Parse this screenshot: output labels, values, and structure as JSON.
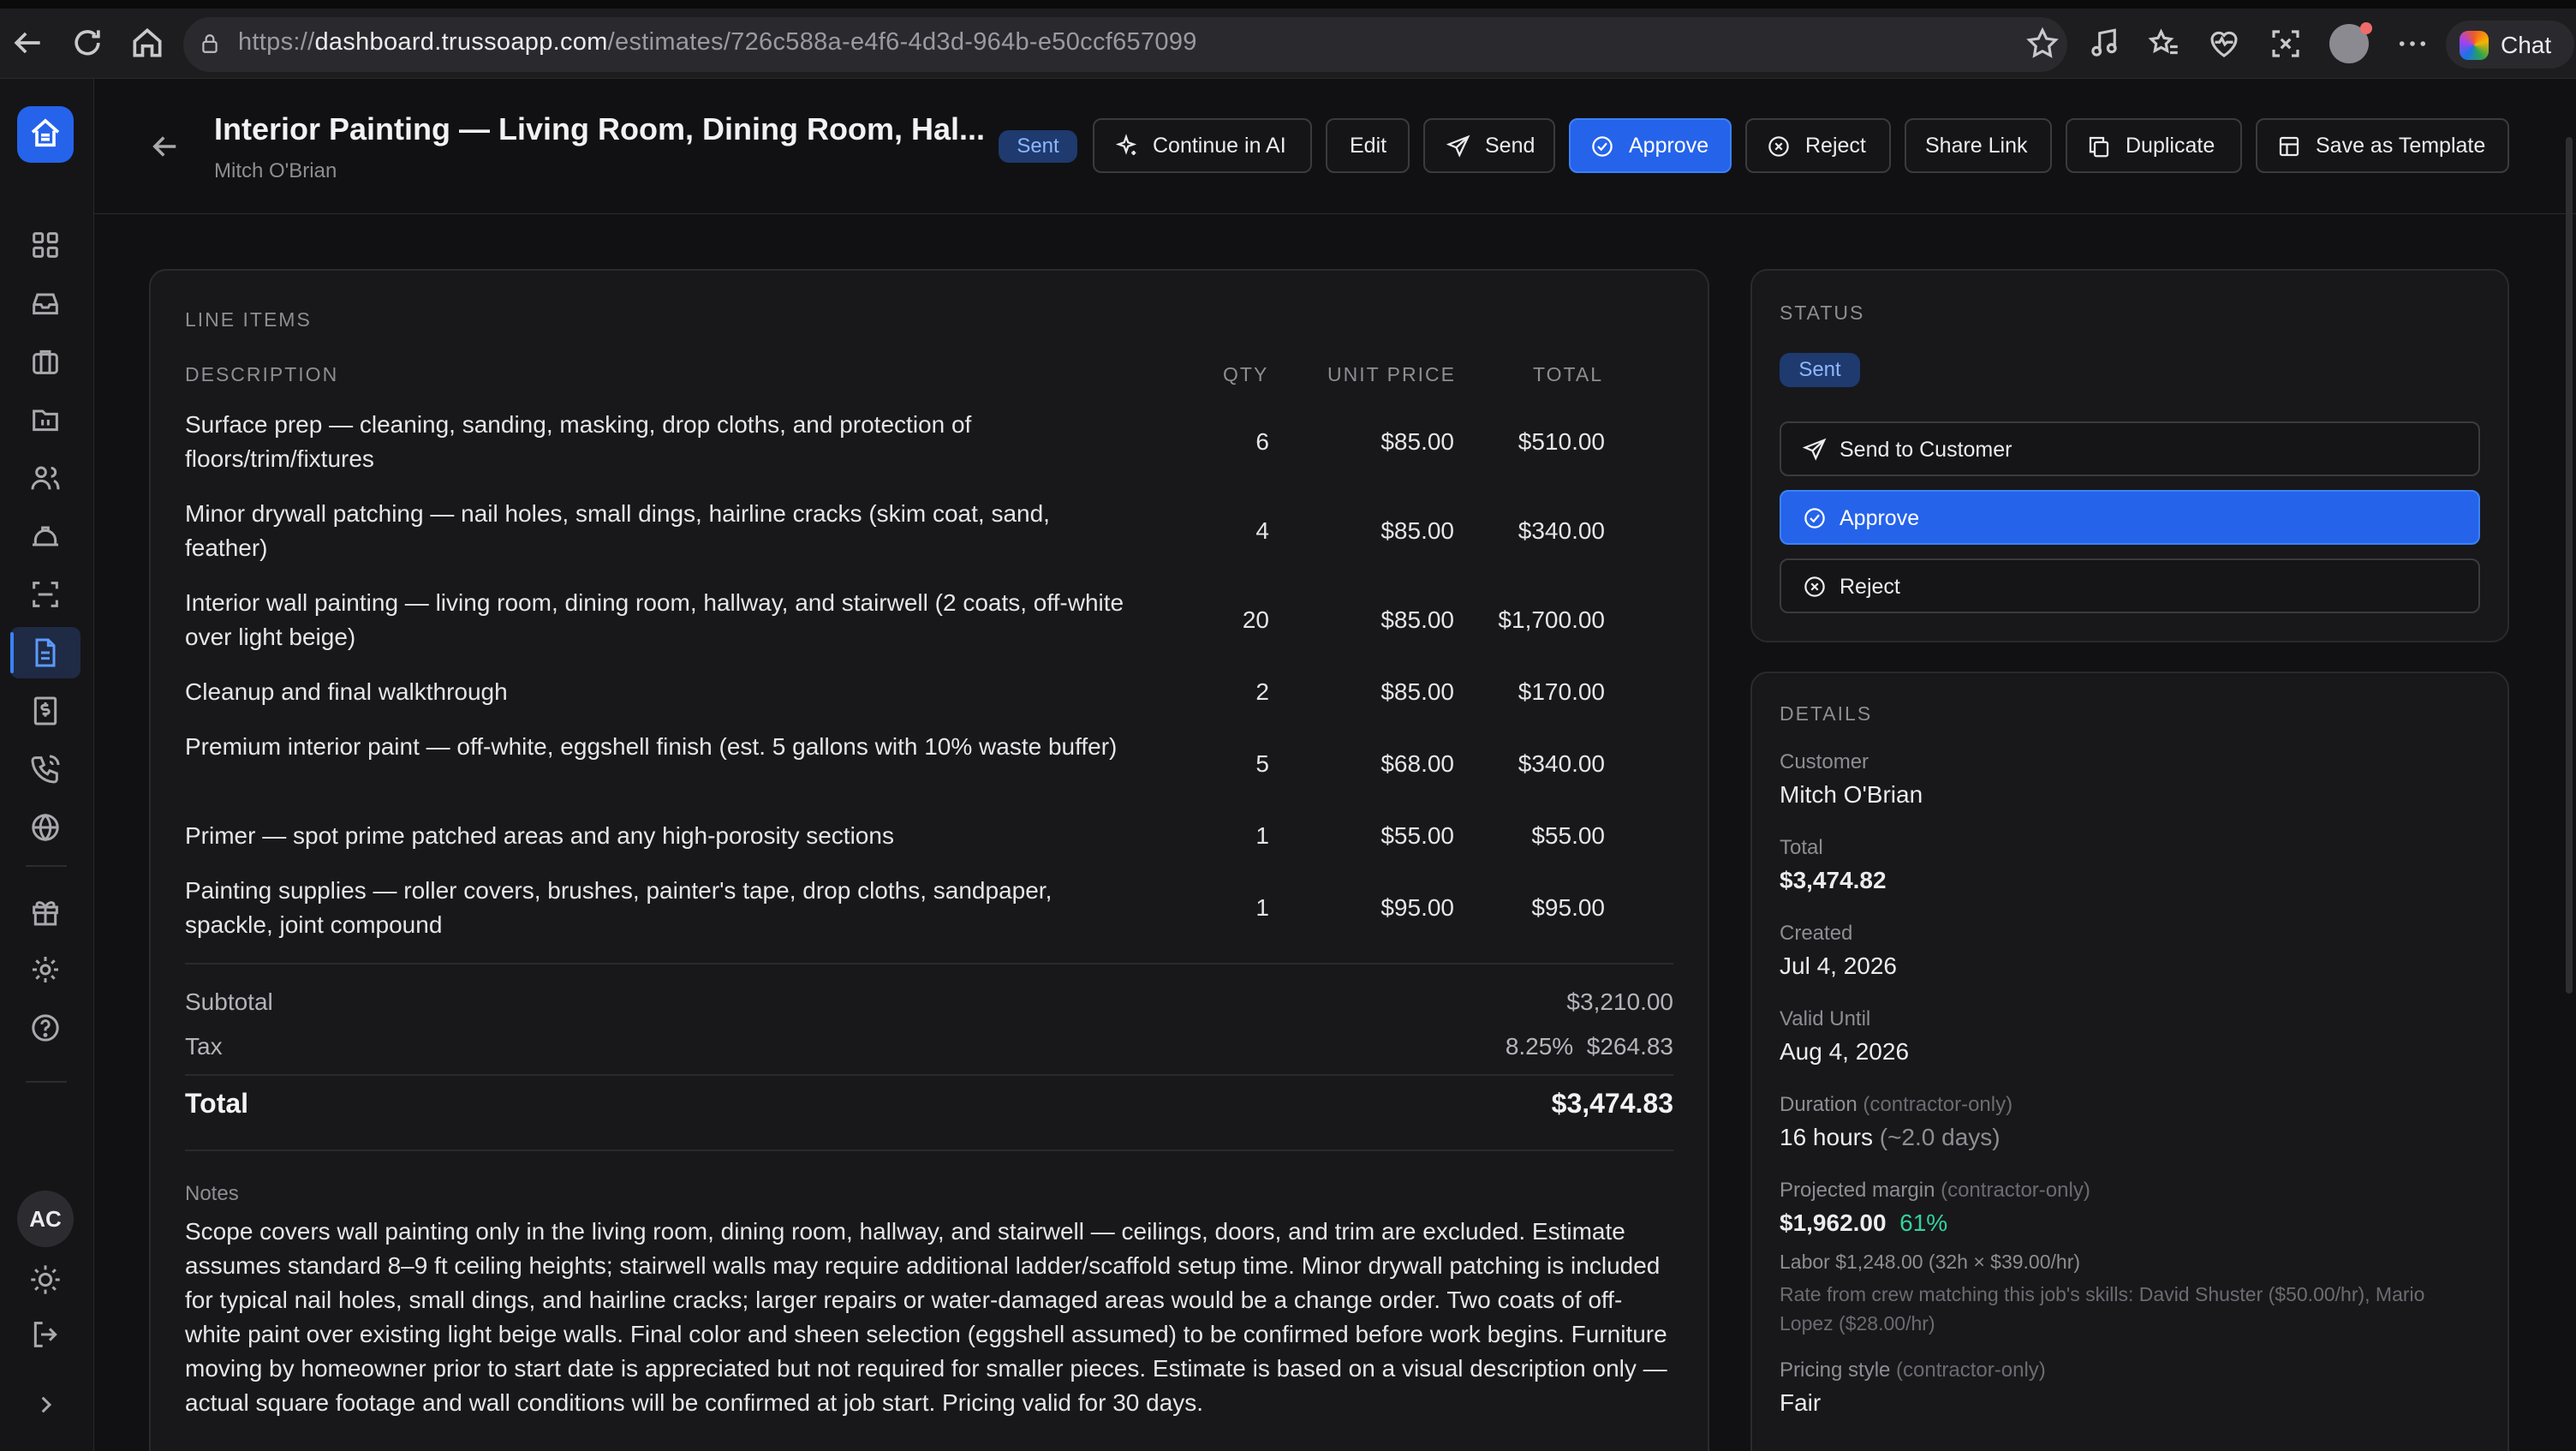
{
  "browser": {
    "url_prefix": "https://",
    "url_host": "dashboard.trussoapp.com",
    "url_path": "/estimates/726c588a-e4f6-4d3d-964b-e50ccf657099",
    "chat_label": "Chat"
  },
  "header": {
    "title": "Interior Painting — Living Room, Dining Room, Hal...",
    "subtitle": "Mitch O'Brian",
    "status_badge": "Sent",
    "buttons": {
      "continue_ai": "Continue in AI",
      "edit": "Edit",
      "send": "Send",
      "approve": "Approve",
      "reject": "Reject",
      "share_link": "Share Link",
      "duplicate": "Duplicate",
      "save_template": "Save as Template"
    }
  },
  "line_items": {
    "section_label": "LINE ITEMS",
    "columns": {
      "description": "DESCRIPTION",
      "qty": "QTY",
      "unit_price": "UNIT PRICE",
      "total": "TOTAL"
    },
    "rows": [
      {
        "description": "Surface prep — cleaning, sanding, masking, drop cloths, and protection of floors/trim/fixtures",
        "qty": "6",
        "unit_price": "$85.00",
        "total": "$510.00"
      },
      {
        "description": "Minor drywall patching — nail holes, small dings, hairline cracks (skim coat, sand, feather)",
        "qty": "4",
        "unit_price": "$85.00",
        "total": "$340.00"
      },
      {
        "description": "Interior wall painting — living room, dining room, hallway, and stairwell (2 coats, off-white over light beige)",
        "qty": "20",
        "unit_price": "$85.00",
        "total": "$1,700.00"
      },
      {
        "description": "Cleanup and final walkthrough",
        "qty": "2",
        "unit_price": "$85.00",
        "total": "$170.00"
      },
      {
        "description": "Premium interior paint — off-white, eggshell finish (est. 5 gallons with 10% waste buffer)",
        "qty": "5",
        "unit_price": "$68.00",
        "total": "$340.00"
      },
      {
        "description": "Primer — spot prime patched areas and any high-porosity sections",
        "qty": "1",
        "unit_price": "$55.00",
        "total": "$55.00"
      },
      {
        "description": "Painting supplies — roller covers, brushes, painter's tape, drop cloths, sandpaper, spackle, joint compound",
        "qty": "1",
        "unit_price": "$95.00",
        "total": "$95.00"
      }
    ],
    "subtotal_label": "Subtotal",
    "subtotal_value": "$3,210.00",
    "tax_label": "Tax",
    "tax_rate": "8.25%",
    "tax_value": "$264.83",
    "total_label": "Total",
    "total_value": "$3,474.83",
    "notes_label": "Notes",
    "notes_text": "Scope covers wall painting only in the living room, dining room, hallway, and stairwell — ceilings, doors, and trim are excluded. Estimate assumes standard 8–9 ft ceiling heights; stairwell walls may require additional ladder/scaffold setup time. Minor drywall patching is included for typical nail holes, small dings, and hairline cracks; larger repairs or water-damaged areas would be a change order. Two coats of off-white paint over existing light beige walls. Final color and sheen selection (eggshell assumed) to be confirmed before work begins. Furniture moving by homeowner prior to start date is appreciated but not required for smaller pieces. Estimate is based on a visual description only — actual square footage and wall conditions will be confirmed at job start. Pricing valid for 30 days."
  },
  "status": {
    "section_label": "STATUS",
    "badge": "Sent",
    "send_to_customer": "Send to Customer",
    "approve": "Approve",
    "reject": "Reject"
  },
  "details": {
    "section_label": "DETAILS",
    "customer_label": "Customer",
    "customer_value": "Mitch O'Brian",
    "total_label": "Total",
    "total_value": "$3,474.82",
    "created_label": "Created",
    "created_value": "Jul 4, 2026",
    "valid_until_label": "Valid Until",
    "valid_until_value": "Aug 4, 2026",
    "duration_label": "Duration",
    "contractor_only": "(contractor-only)",
    "duration_value": "16 hours",
    "duration_days": "(~2.0 days)",
    "margin_label": "Projected margin",
    "margin_value": "$1,962.00",
    "margin_pct": "61%",
    "labor_line": "Labor $1,248.00 (32h × $39.00/hr)",
    "rate_note": "Rate from crew matching this job's skills: David Shuster ($50.00/hr), Mario Lopez ($28.00/hr)",
    "pricing_label": "Pricing style",
    "pricing_value": "Fair"
  },
  "user": {
    "initials": "AC"
  }
}
